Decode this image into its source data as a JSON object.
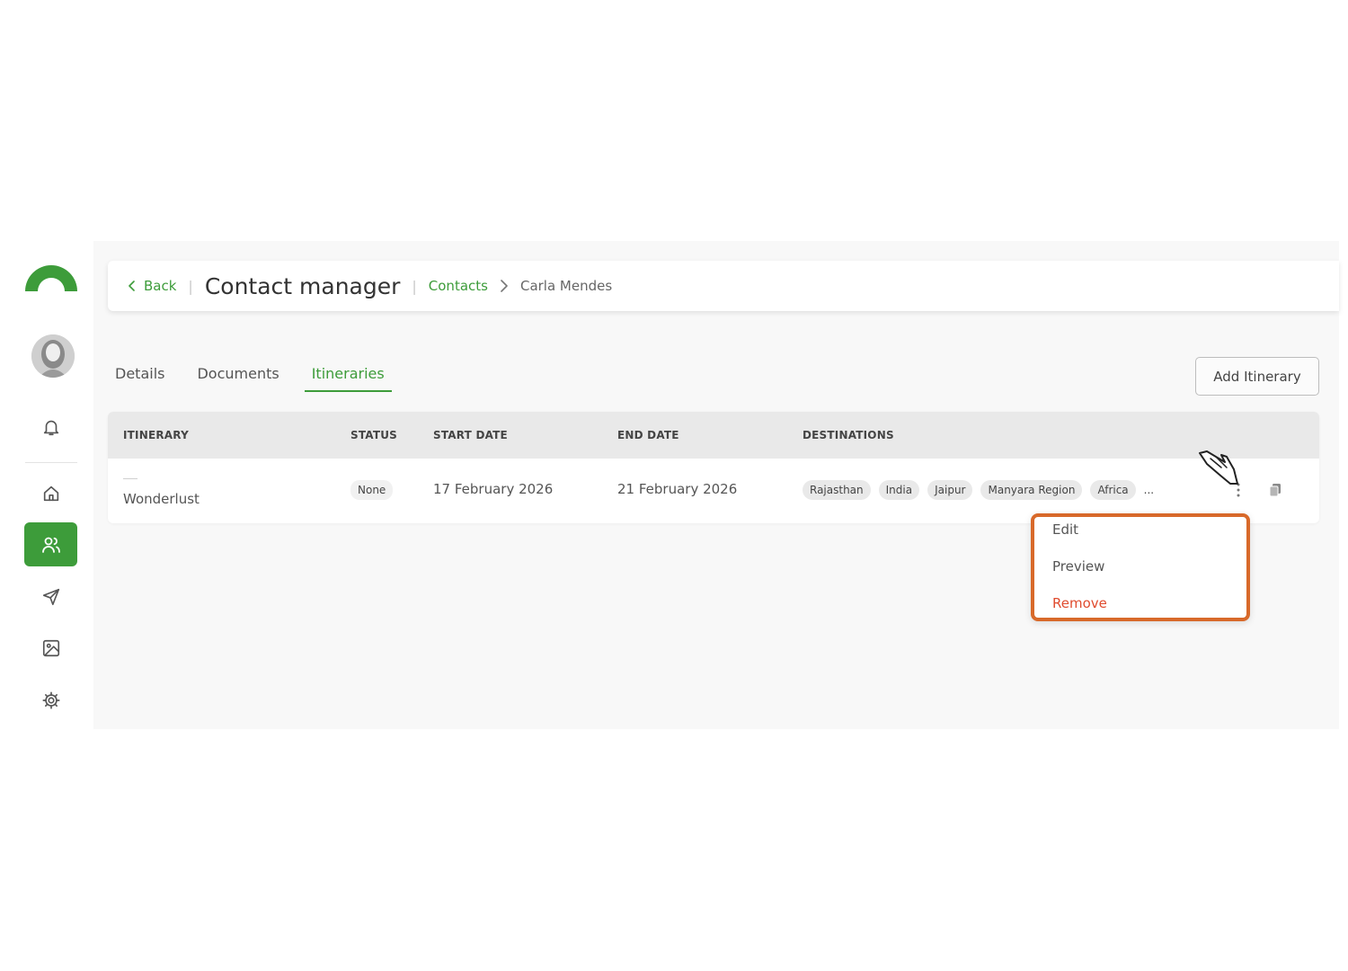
{
  "header": {
    "back_label": "Back",
    "title": "Contact manager",
    "breadcrumb_link": "Contacts",
    "breadcrumb_current": "Carla Mendes"
  },
  "tabs": [
    {
      "label": "Details",
      "active": false
    },
    {
      "label": "Documents",
      "active": false
    },
    {
      "label": "Itineraries",
      "active": true
    }
  ],
  "add_button_label": "Add Itinerary",
  "table": {
    "columns": [
      "ITINERARY",
      "STATUS",
      "START DATE",
      "END DATE",
      "DESTINATIONS"
    ],
    "rows": [
      {
        "name": "Wonderlust",
        "status": "None",
        "start_date": "17 February 2026",
        "end_date": "21 February 2026",
        "destinations": [
          "Rajasthan",
          "India",
          "Jaipur",
          "Manyara Region",
          "Africa"
        ],
        "overflow_marker": "..."
      }
    ]
  },
  "row_menu": {
    "items": [
      {
        "label": "Edit"
      },
      {
        "label": "Preview"
      },
      {
        "label": "Remove"
      }
    ]
  },
  "icons": {
    "sidebar": [
      "logo-icon",
      "avatar",
      "bell-icon",
      "home-icon",
      "users-icon",
      "send-icon",
      "image-icon",
      "gear-icon"
    ],
    "row": [
      "kebab-menu-icon",
      "copy-icon"
    ]
  },
  "colors": {
    "brand_green": "#3d9c3a",
    "highlight_orange": "#d8692a",
    "danger_red": "#e04b2e"
  }
}
